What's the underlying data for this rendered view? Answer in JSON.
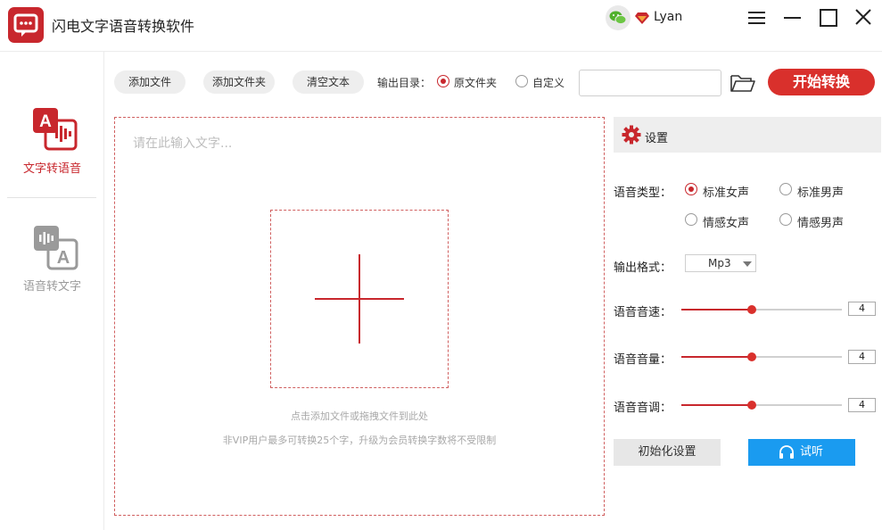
{
  "app": {
    "title": "闪电文字语音转换软件"
  },
  "user": {
    "name": "Lyan"
  },
  "colors": {
    "brand": "#c8272d",
    "start_button": "#d9302c",
    "listen_button": "#1a9bf0"
  },
  "sidebar": {
    "items": [
      {
        "label": "文字转语音",
        "icon": "text-to-speech-icon",
        "active": true
      },
      {
        "label": "语音转文字",
        "icon": "speech-to-text-icon",
        "active": false
      }
    ]
  },
  "toolbar": {
    "add_file": "添加文件",
    "add_folder": "添加文件夹",
    "clear_text": "清空文本",
    "output_dir_label": "输出目录：",
    "options": [
      {
        "label": "原文件夹",
        "selected": true
      },
      {
        "label": "自定义",
        "selected": false
      }
    ],
    "path_value": "",
    "start_button": "开始转换"
  },
  "editor": {
    "placeholder": "请在此输入文字...",
    "drop_hint": "点击添加文件或拖拽文件到此处",
    "vip_hint": "非VIP用户最多可转换25个字，升级为会员转换字数将不受限制"
  },
  "settings": {
    "title": "设置",
    "voice_type_label": "语音类型：",
    "voice_types": [
      {
        "label": "标准女声",
        "selected": true
      },
      {
        "label": "标准男声",
        "selected": false
      },
      {
        "label": "情感女声",
        "selected": false
      },
      {
        "label": "情感男声",
        "selected": false
      }
    ],
    "format_label": "输出格式：",
    "format_value": "Mp3",
    "speed_label": "语音音速：",
    "speed_value": "4",
    "volume_label": "语音音量：",
    "volume_value": "4",
    "pitch_label": "语音音调：",
    "pitch_value": "4",
    "slider_levels": {
      "speed": 0.44,
      "volume": 0.44,
      "pitch": 0.44
    },
    "reset_button": "初始化设置",
    "listen_button": "试听"
  }
}
